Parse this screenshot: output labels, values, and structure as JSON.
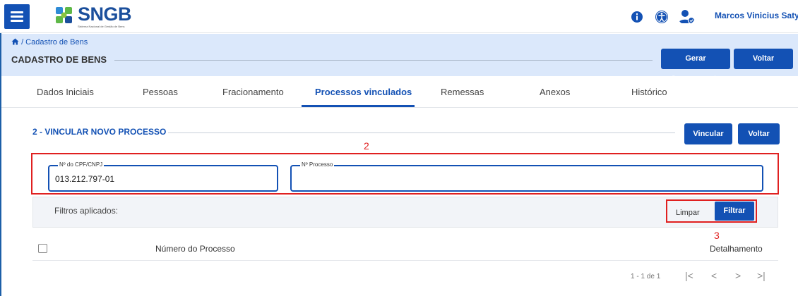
{
  "app": {
    "logo_text": "SNGB",
    "logo_subtitle": "Sistema Nacional de Gestão de Bens",
    "user_name": "Marcos Vinicius Satyro C..."
  },
  "header": {
    "breadcrumb": "/ Cadastro de Bens",
    "page_title": "CADASTRO DE BENS",
    "gerar_label": "Gerar Comprovante",
    "voltar_label": "Voltar"
  },
  "tabs": [
    {
      "label": "Dados Iniciais"
    },
    {
      "label": "Pessoas"
    },
    {
      "label": "Fracionamento"
    },
    {
      "label": "Processos vinculados",
      "active": true
    },
    {
      "label": "Remessas"
    },
    {
      "label": "Anexos"
    },
    {
      "label": "Histórico"
    }
  ],
  "section": {
    "title": "2 - VINCULAR NOVO PROCESSO",
    "vincular_label": "Vincular",
    "voltar_label": "Voltar"
  },
  "form": {
    "cpf_label": "Nº do CPF/CNPJ",
    "cpf_value": "013.212.797-01",
    "processo_label": "Nº Processo",
    "processo_value": ""
  },
  "filters": {
    "label": "Filtros aplicados:",
    "limpar_label": "Limpar",
    "filtrar_label": "Filtrar"
  },
  "table": {
    "columns": [
      "Número do Processo",
      "Detalhamento"
    ]
  },
  "pagination": {
    "range": "1 - 1 de 1",
    "first": "|<",
    "prev": "<",
    "next": ">",
    "last": ">|"
  },
  "annotations": [
    "2",
    "3"
  ],
  "colors": {
    "primary": "#1351b4",
    "annotation": "#e02020",
    "band": "#dbe8fb"
  },
  "icons": [
    "menu-icon",
    "info-icon",
    "accessibility-icon",
    "user-icon",
    "home-icon"
  ]
}
